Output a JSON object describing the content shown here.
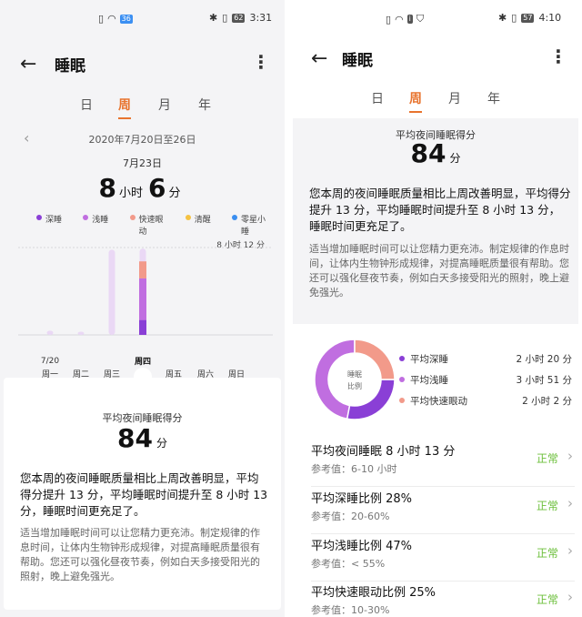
{
  "left": {
    "status": {
      "time": "3:31",
      "battery": "62",
      "net_badge": "36"
    },
    "title": "睡眠",
    "tabs": [
      {
        "label": "日"
      },
      {
        "label": "周"
      },
      {
        "label": "月"
      },
      {
        "label": "年"
      }
    ],
    "active_tab": "周",
    "date_range": "2020年7月20日至26日",
    "selected_day": "7月23日",
    "duration": {
      "hours": "8",
      "hours_unit": "小时",
      "minutes": "6",
      "minutes_unit": "分"
    },
    "legend": [
      {
        "label": "深睡",
        "color": "#8a3fd6"
      },
      {
        "label": "浅睡",
        "color": "#c06ee0"
      },
      {
        "label": "快速眼动",
        "color": "#f29a8a"
      },
      {
        "label": "清醒",
        "color": "#f5c242"
      },
      {
        "label": "零星小睡",
        "color": "#3a8ef0"
      }
    ],
    "chart_data": {
      "type": "bar",
      "stacked": true,
      "categories": [
        "周一",
        "周二",
        "周三",
        "周四",
        "周五",
        "周六",
        "周日"
      ],
      "category_sublabels": [
        "7/20",
        "",
        "",
        "",
        "",
        "",
        ""
      ],
      "max_label": "8 小时 12 分",
      "highlighted_category": "周四",
      "series": [
        {
          "name": "深睡",
          "color": "#8a3fd6",
          "values": [
            0,
            0,
            0.0,
            1.4,
            0,
            0,
            0
          ]
        },
        {
          "name": "浅睡",
          "color": "#c06ee0",
          "values": [
            0,
            0,
            0.0,
            3.9,
            0,
            0,
            0
          ]
        },
        {
          "name": "快速眼动",
          "color": "#f29a8a",
          "values": [
            0,
            0,
            0.0,
            1.6,
            0,
            0,
            0
          ]
        }
      ],
      "faint_values": [
        0.4,
        0.3,
        8.0,
        8.1,
        0,
        0,
        0
      ],
      "ylim": [
        0,
        8.2
      ]
    },
    "score_label": "平均夜间睡眠得分",
    "score_value": "84",
    "score_unit": "分",
    "summary": "您本周的夜间睡眠质量相比上周改善明显，平均得分提升 13 分，平均睡眠时间提升至 8 小时 13 分，睡眠时间更充足了。",
    "advice": "适当增加睡眠时间可以让您精力更充沛。制定规律的作息时间，让体内生物钟形成规律，对提高睡眠质量很有帮助。您还可以强化昼夜节奏，例如白天多接受阳光的照射，晚上避免强光。"
  },
  "right": {
    "status": {
      "time": "4:10",
      "battery": "57"
    },
    "title": "睡眠",
    "tabs": [
      {
        "label": "日"
      },
      {
        "label": "周"
      },
      {
        "label": "月"
      },
      {
        "label": "年"
      }
    ],
    "active_tab": "周",
    "score_label": "平均夜间睡眠得分",
    "score_value": "84",
    "score_unit": "分",
    "summary": "您本周的夜间睡眠质量相比上周改善明显，平均得分提升 13 分，平均睡眠时间提升至 8 小时 13 分，睡眠时间更充足了。",
    "advice": "适当增加睡眠时间可以让您精力更充沛。制定规律的作息时间，让体内生物钟形成规律，对提高睡眠质量很有帮助。您还可以强化昼夜节奏，例如白天多接受阳光的照射，晚上避免强光。",
    "donut_center_label": "睡眠比例",
    "ratio_rows": [
      {
        "label": "平均深睡",
        "value": "2 小时 20 分",
        "color": "#8a3fd6",
        "percent": 28
      },
      {
        "label": "平均浅睡",
        "value": "3 小时 51 分",
        "color": "#c06ee0",
        "percent": 47
      },
      {
        "label": "平均快速眼动",
        "value": "2 小时 2 分",
        "color": "#f29a8a",
        "percent": 25
      }
    ],
    "metrics": [
      {
        "title": "平均夜间睡眠  8 小时 13 分",
        "ref": "参考值：6-10 小时",
        "status": "正常"
      },
      {
        "title": "平均深睡比例  28%",
        "ref": "参考值：20-60%",
        "status": "正常"
      },
      {
        "title": "平均浅睡比例  47%",
        "ref": "参考值：< 55%",
        "status": "正常"
      },
      {
        "title": "平均快速眼动比例  25%",
        "ref": "参考值：10-30%",
        "status": "正常"
      }
    ]
  }
}
